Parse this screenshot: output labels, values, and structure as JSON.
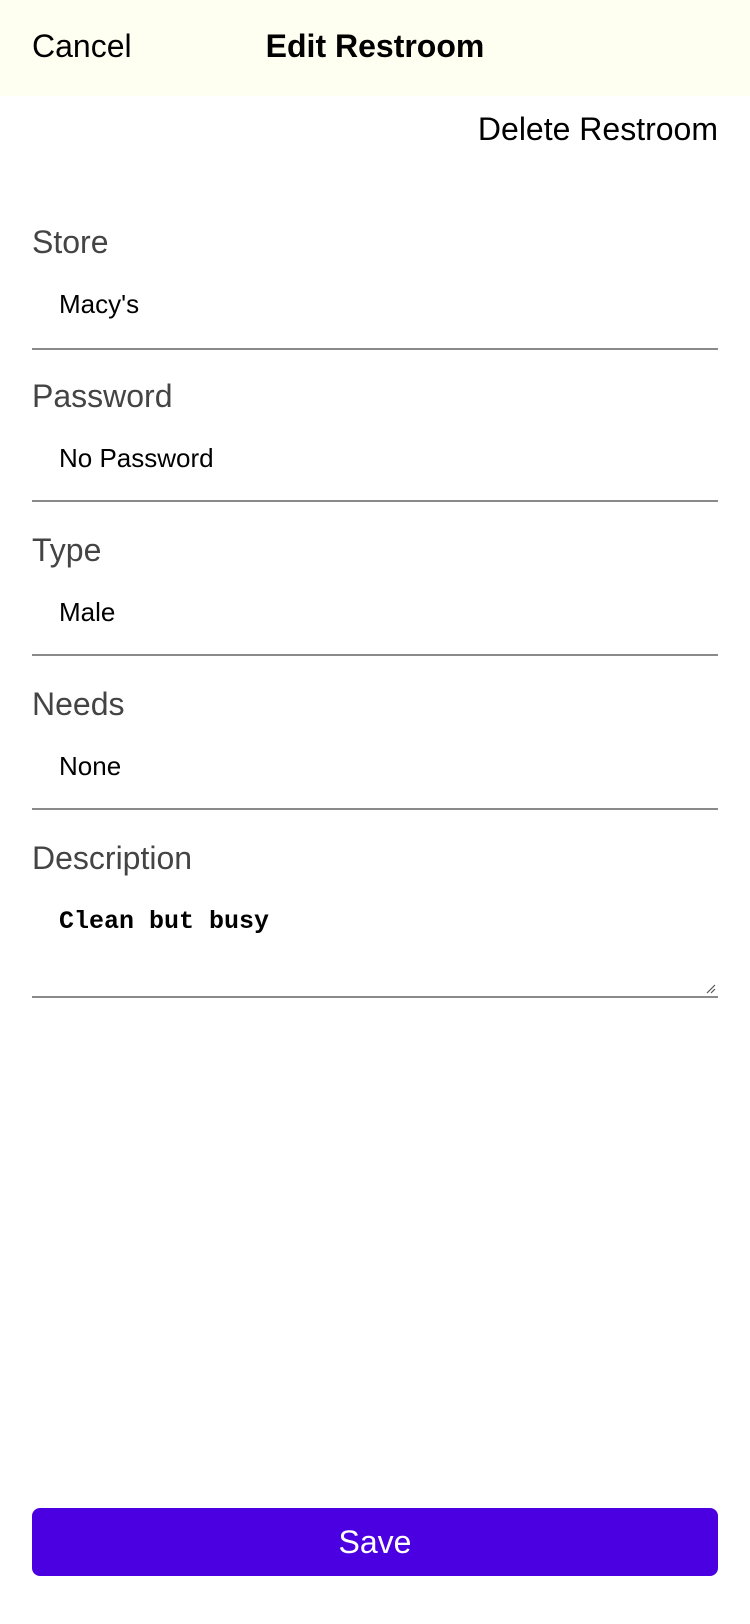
{
  "header": {
    "cancel_label": "Cancel",
    "title": "Edit Restroom",
    "background_color": "#fefef1"
  },
  "delete_label": "Delete Restroom",
  "form": {
    "store": {
      "label": "Store",
      "value": "Macy's"
    },
    "password": {
      "label": "Password",
      "value": "No Password"
    },
    "type": {
      "label": "Type",
      "value": "Male"
    },
    "needs": {
      "label": "Needs",
      "value": "None"
    },
    "description": {
      "label": "Description",
      "value": "Clean but busy"
    }
  },
  "save_label": "Save",
  "colors": {
    "accent": "#4b00e1",
    "label_text": "#444444",
    "divider": "#8a8a8a"
  }
}
